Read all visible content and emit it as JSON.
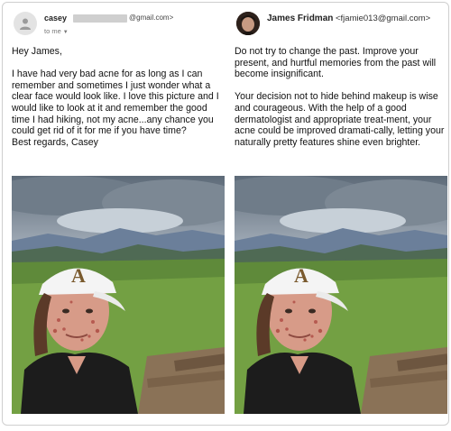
{
  "left": {
    "sender_name": "casey",
    "sender_email_domain": "@gmail.com>",
    "to_label": "to me",
    "greeting": "Hey James,",
    "paragraph": "I have had very bad acne for as long as I can remember and sometimes I just wonder what a clear face would look like. I love this picture and I would like to look at it and remember the good time I had hiking, not my acne...any chance you could get rid of it for me if you have time?",
    "signoff": "Best regards, Casey",
    "hat_logo": "A"
  },
  "right": {
    "sender_name": "James Fridman",
    "sender_email": "<fjamie013@gmail.com>",
    "paragraph1": "Do not try to change the past. Improve your present, and hurtful memories from the past will become insignificant.",
    "paragraph2": "Your decision not to hide behind makeup is wise and courageous. With the help of a good dermatologist and appropriate treat-ment, your acne could be improved dramati-cally, letting your naturally pretty features shine even brighter.",
    "hat_logo": "A"
  },
  "icons": {
    "default_avatar": "person-silhouette-icon",
    "expand": "caret-down-icon"
  },
  "colors": {
    "border": "#cfcfcf",
    "text": "#111111",
    "muted": "#777777",
    "redaction": "#cfcfcf"
  }
}
